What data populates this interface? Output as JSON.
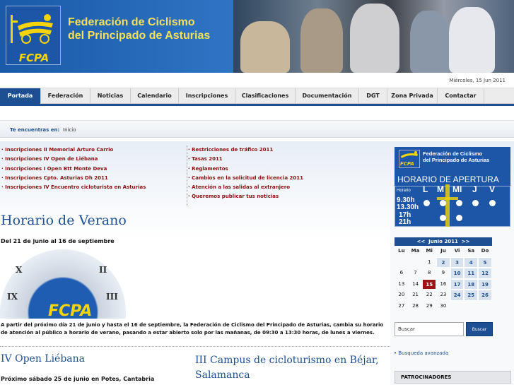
{
  "header": {
    "logo_text": "FCPA",
    "title_line1": "Federación de Ciclismo",
    "title_line2": "del Principado de Asturias"
  },
  "date": "Miércoles, 15 Jun 2011",
  "nav": {
    "tabs": [
      {
        "label": "Portada",
        "active": true
      },
      {
        "label": "Federación",
        "active": false
      },
      {
        "label": "Noticias",
        "active": false
      },
      {
        "label": "Calendario",
        "active": false
      },
      {
        "label": "Inscripciones",
        "active": false
      },
      {
        "label": "Clasificaciones",
        "active": false
      },
      {
        "label": "Documentación",
        "active": false
      },
      {
        "label": "DGT",
        "active": false
      },
      {
        "label": "Zona Privada",
        "active": false
      },
      {
        "label": "Contactar",
        "active": false
      }
    ]
  },
  "breadcrumb": {
    "label": "Te encuentras en:",
    "home": "Inicio"
  },
  "links_left": [
    "Inscripciones II Memorial Arturo Carrio",
    "Inscripciones IV Open de Liébana",
    "Inscripciones I Open Btt Monte Deva",
    "Inscripciones Cpto. Asturias Dh 2011",
    "Inscripciones IV Encuentro cicloturista en Asturias"
  ],
  "links_right": [
    "Restricciones de tráfico 2011",
    "Tasas 2011",
    "Reglamentos",
    "Cambios en la solicitud de licencia 2011",
    "Atención a las salidas al extranjero",
    "Queremos publicar tus noticias"
  ],
  "article": {
    "title": "Horario de Verano",
    "date_range": "Del 21 de junio al 16 de septiembre",
    "clock_logo": "FCPA",
    "body": "A partir del próximo día 21 de junio y hasta el 16 de septiembre, la Federación de Ciclismo del Principado de Asturias, cambia su horario de atención al público a horario de verano, pasando a estar abierto solo por las mañanas, de 09:30 a 13:30 horas, de lunes a viernes."
  },
  "news": [
    {
      "title": "IV Open Liébana",
      "subtitle": "Próximo sábado 25 de junio en Potes, Cantabria"
    },
    {
      "title": "III Campus de cicloturismo en Béjar, Salamanca"
    }
  ],
  "hours_widget": {
    "logo_text": "FCPA",
    "fed_line1": "Federación de Ciclismo",
    "fed_line2": "del Principado de Asturias",
    "title": "HORARIO DE APERTURA",
    "label": "Horario",
    "days": [
      "L",
      "M",
      "MI",
      "J",
      "V"
    ],
    "slot1": "9.30h\n13.30h",
    "slot2": "17h\n21h"
  },
  "calendar": {
    "prev": "<<",
    "month": "Junio 2011",
    "next": ">>",
    "weekdays": [
      "Lu",
      "Ma",
      "Mi",
      "Ju",
      "Vi",
      "Sa",
      "Do"
    ],
    "weeks": [
      [
        "",
        "",
        "1",
        "2",
        "3",
        "4",
        "5"
      ],
      [
        "6",
        "7",
        "8",
        "9",
        "10",
        "11",
        "12"
      ],
      [
        "13",
        "14",
        "15",
        "16",
        "17",
        "18",
        "19"
      ],
      [
        "20",
        "21",
        "22",
        "23",
        "24",
        "25",
        "26"
      ],
      [
        "27",
        "28",
        "29",
        "30",
        "",
        "",
        ""
      ]
    ],
    "linked_days": [
      "2",
      "3",
      "4",
      "5",
      "10",
      "11",
      "12",
      "17",
      "18",
      "19",
      "24",
      "25",
      "26"
    ],
    "today": "15"
  },
  "search": {
    "placeholder": "Buscar",
    "button": "Buscar",
    "advanced": "Busqueda avanzada"
  },
  "sponsors_title": "PATROCINADORES",
  "colors": {
    "brand_blue": "#1d4f92",
    "brand_yellow": "#f6d40a",
    "link_red": "#8b1010",
    "today_red": "#9a1616"
  }
}
